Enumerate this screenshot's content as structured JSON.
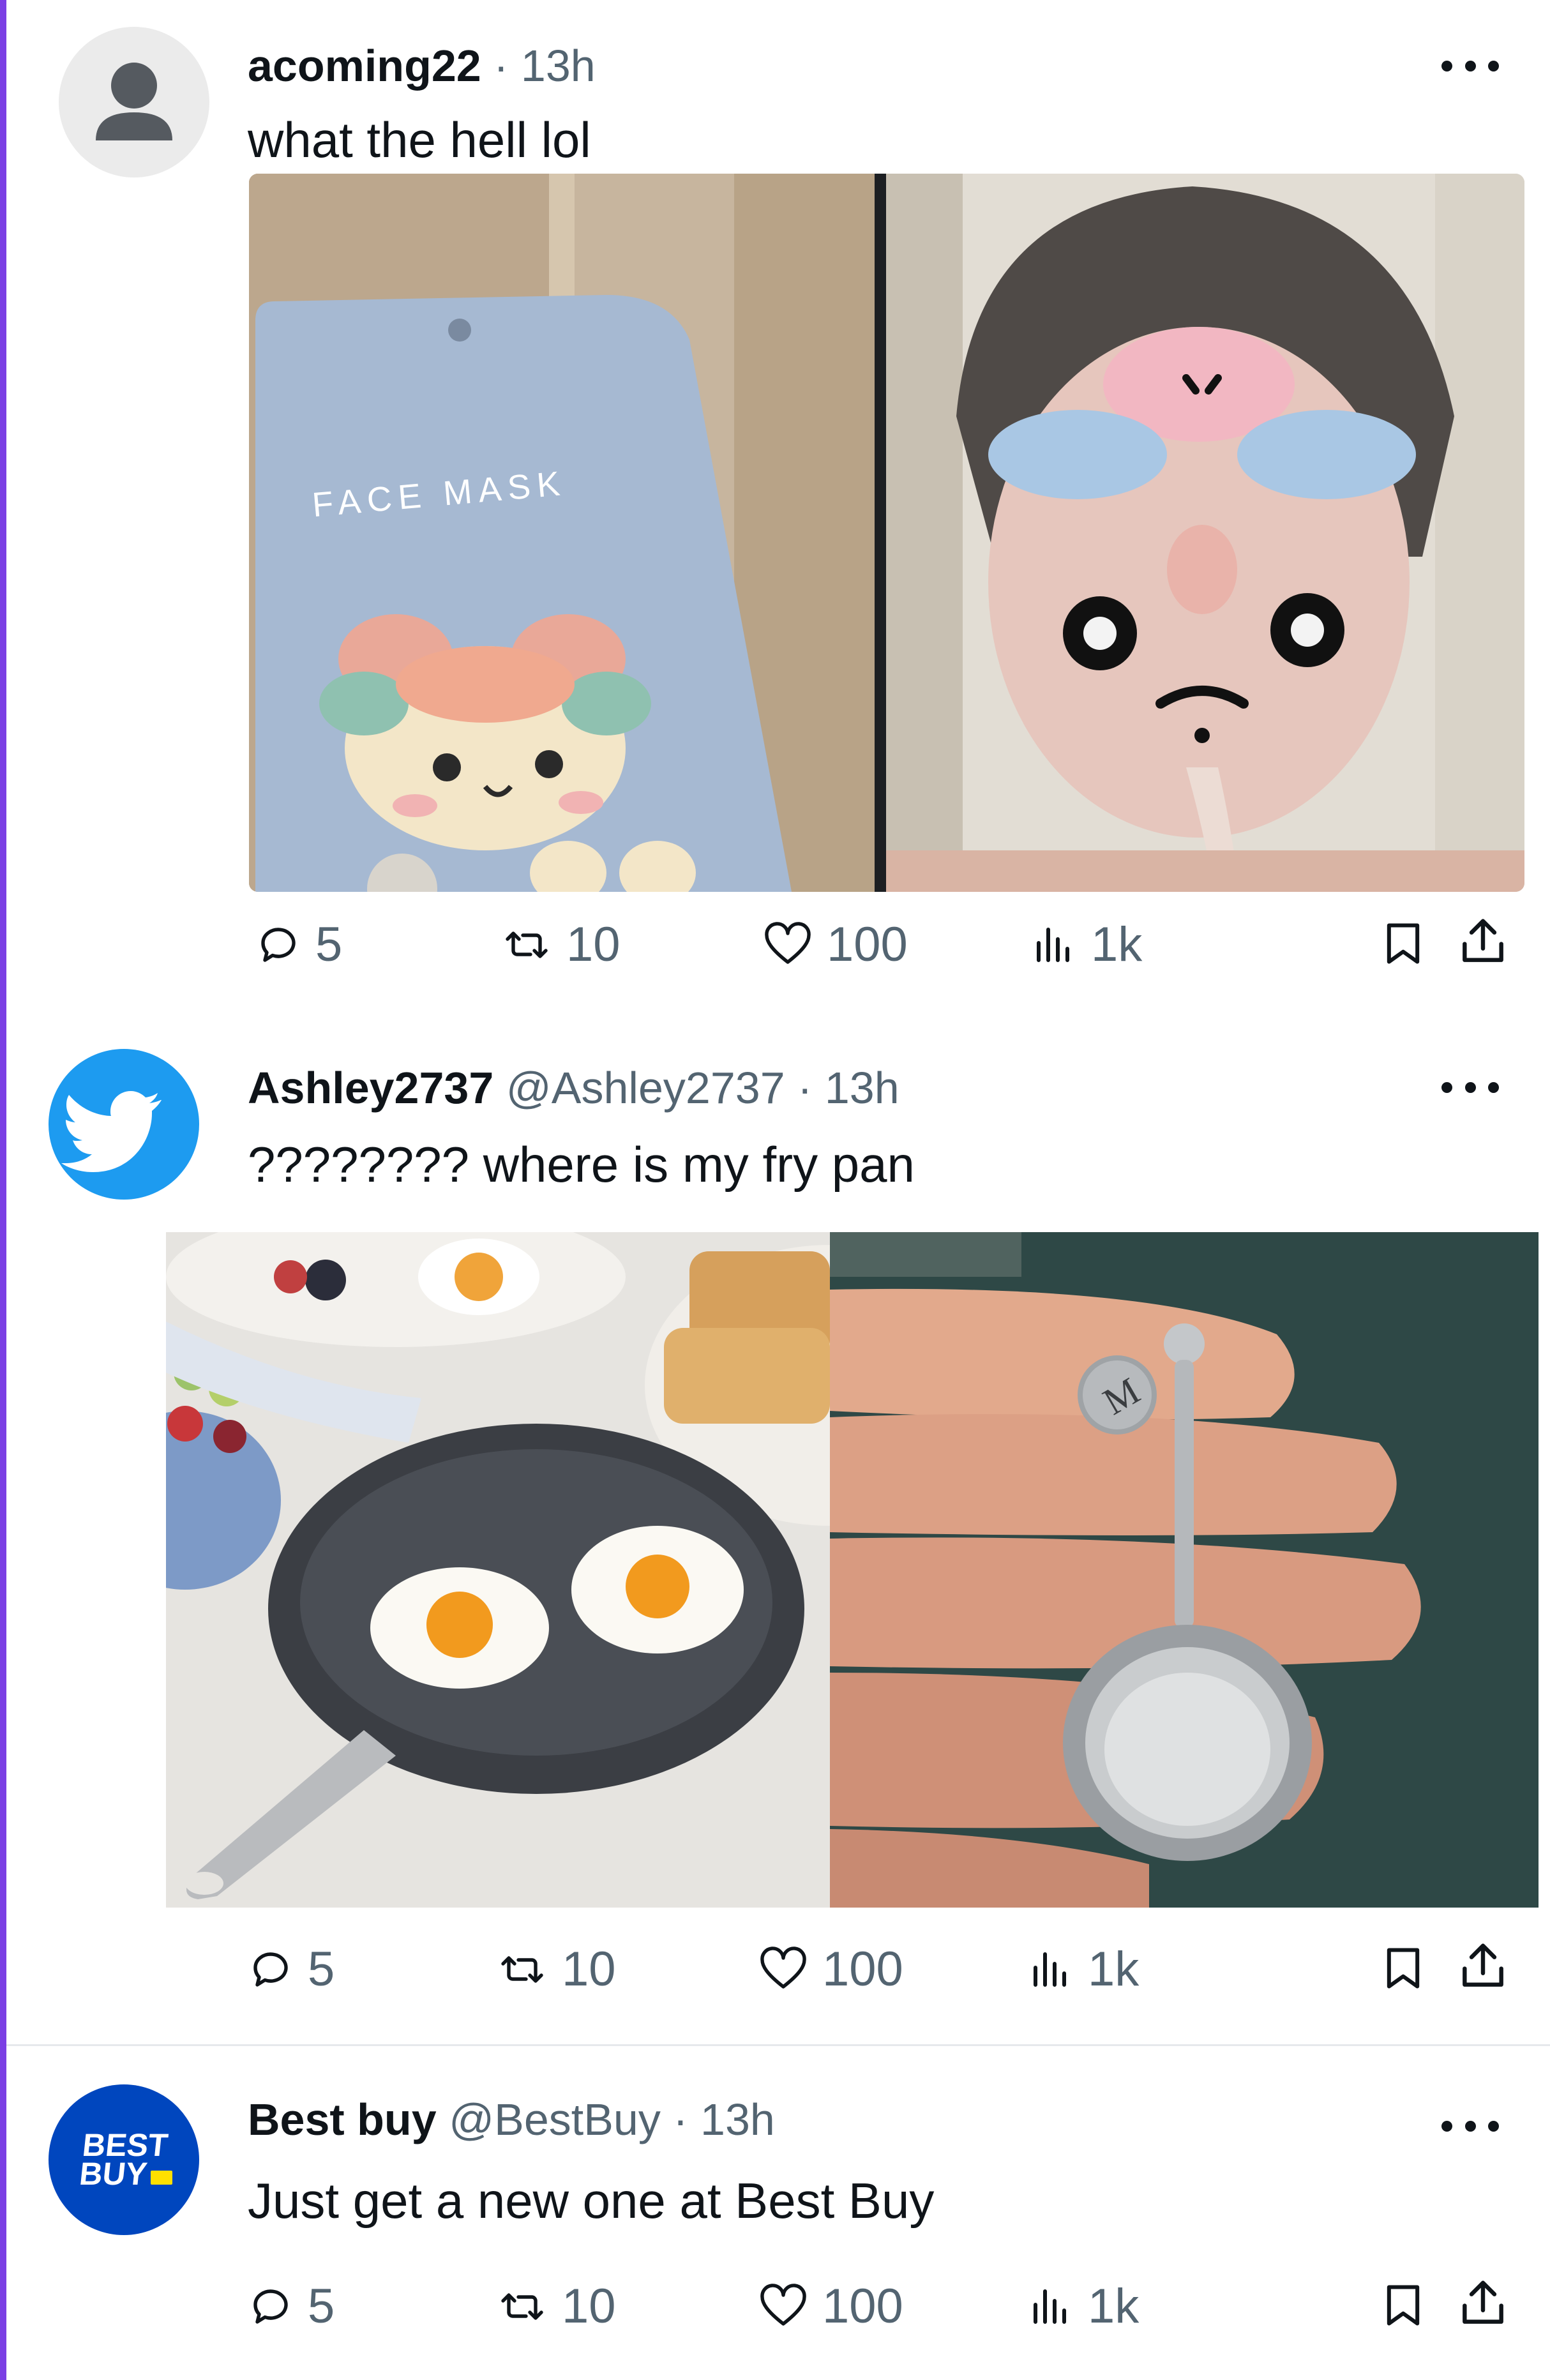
{
  "colors": {
    "accent": "#7b3fe4",
    "twitter_blue": "#1d9bf0",
    "bestbuy_blue": "#0046be",
    "bestbuy_yellow": "#ffe000"
  },
  "tweets": [
    {
      "name": "acoming22",
      "handle": "",
      "time": "· 13h",
      "text": "what the hell lol",
      "avatar_icon": "user-silhouette-icon",
      "media": [
        "chiikawa face mask package",
        "person wearing chiikawa face mask"
      ],
      "replies": "5",
      "retweets": "10",
      "likes": "100",
      "views": "1k"
    },
    {
      "name": "Ashley2737",
      "handle": "@Ashley2737",
      "time": "· 13h",
      "text": "???????? where is my fry pan",
      "avatar_icon": "twitter-bird-icon",
      "media": [
        "fried eggs in frying pan",
        "miniature frying pan charm on fingers"
      ],
      "replies": "5",
      "retweets": "10",
      "likes": "100",
      "views": "1k"
    },
    {
      "name": "Best buy",
      "handle": "@BestBuy",
      "time": "· 13h",
      "text": "Just get a new one at Best Buy",
      "avatar_text": "BEST\nBUY",
      "replies": "5",
      "retweets": "10",
      "likes": "100",
      "views": "1k"
    }
  ],
  "mask_label": "FACE MASK",
  "charm_letter": "M"
}
